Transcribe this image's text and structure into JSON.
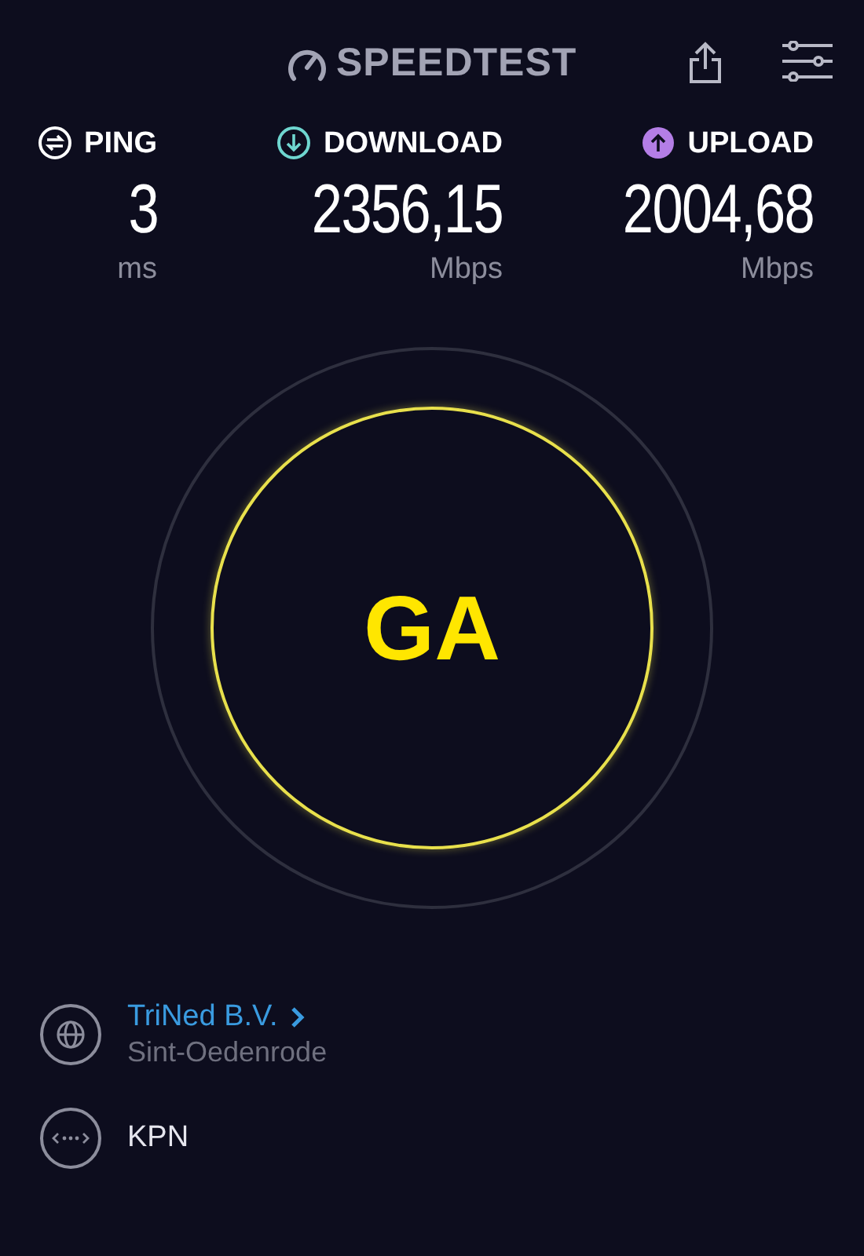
{
  "header": {
    "logo": "SPEEDTEST"
  },
  "metrics": [
    {
      "kind": "ping",
      "label": "PING",
      "value": "3",
      "unit": "ms",
      "color": "#ffffff"
    },
    {
      "kind": "download",
      "label": "DOWNLOAD",
      "value": "2356,15",
      "unit": "Mbps",
      "color": "#6fd6d0"
    },
    {
      "kind": "upload",
      "label": "UPLOAD",
      "value": "2004,68",
      "unit": "Mbps",
      "color": "#b47ee6"
    }
  ],
  "go_button": {
    "label": "GA"
  },
  "server": {
    "name": "TriNed B.V.",
    "location": "Sint-Oedenrode"
  },
  "provider": {
    "name": "KPN"
  }
}
